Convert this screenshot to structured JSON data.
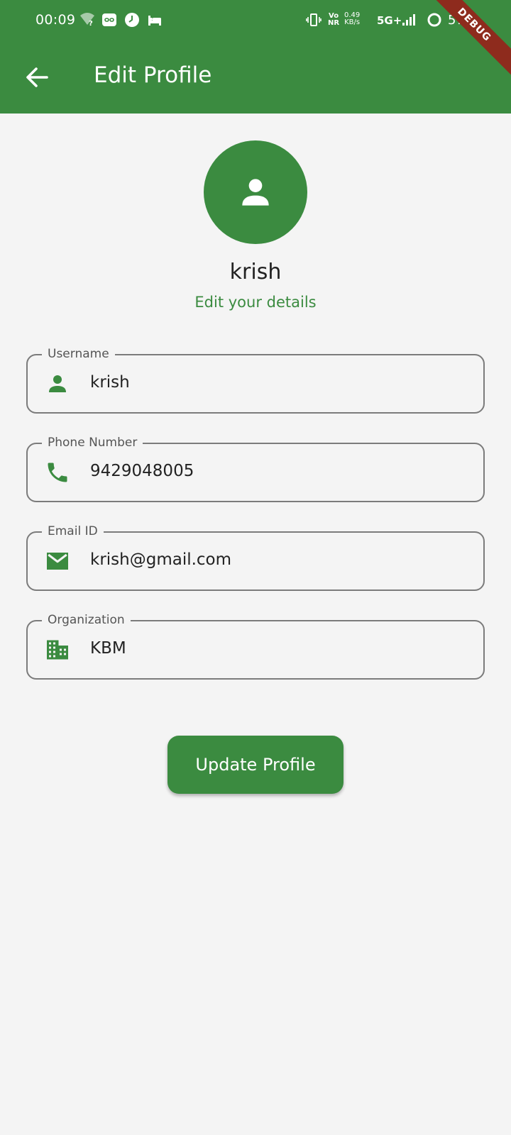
{
  "status_bar": {
    "time": "00:09",
    "net_volte": "Vo\nNR",
    "net_speed": "0.49\nKB/s",
    "network": "5G+",
    "battery": "57%"
  },
  "debug_banner": "DEBUG",
  "app_bar": {
    "title": "Edit Profile",
    "back_icon": "arrow-back-icon"
  },
  "profile": {
    "avatar_icon": "person-icon",
    "name": "krish",
    "subtitle": "Edit your details"
  },
  "form": {
    "username": {
      "label": "Username",
      "value": "krish",
      "icon": "person-icon"
    },
    "phone": {
      "label": "Phone Number",
      "value": "9429048005",
      "icon": "phone-icon"
    },
    "email": {
      "label": "Email ID",
      "value": "krish@gmail.com",
      "icon": "email-icon"
    },
    "organization": {
      "label": "Organization",
      "value": "KBM",
      "icon": "building-icon"
    }
  },
  "update_button": {
    "label": "Update Profile"
  },
  "colors": {
    "primary": "#3b8b40",
    "background": "#f4f4f4",
    "border": "#7b7b7b",
    "debug": "#8e2b1d"
  }
}
